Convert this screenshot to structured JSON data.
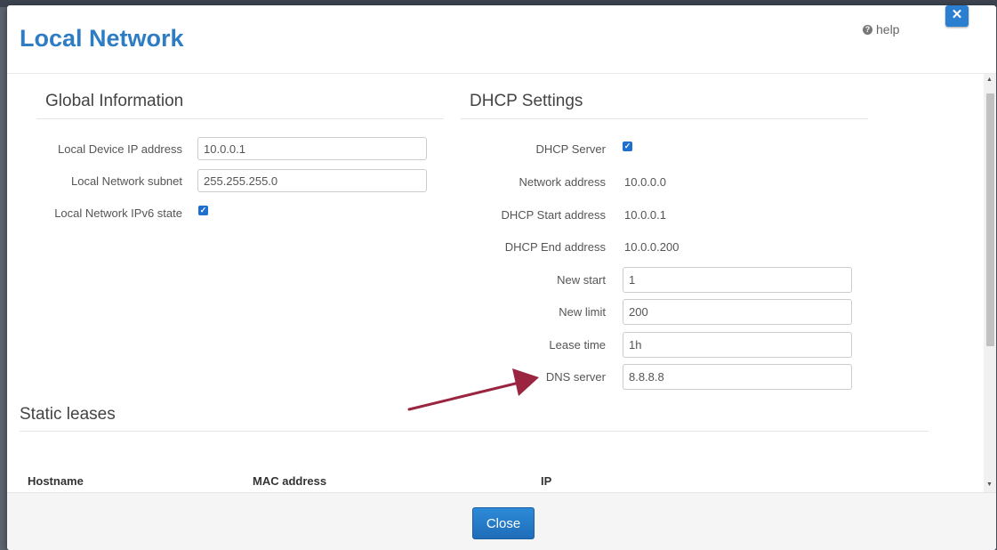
{
  "modal": {
    "title": "Local Network",
    "help_label": "help",
    "close_label": "Close"
  },
  "global_info": {
    "title": "Global Information",
    "device_ip": {
      "label": "Local Device IP address",
      "value": "10.0.0.1"
    },
    "subnet": {
      "label": "Local Network subnet",
      "value": "255.255.255.0"
    },
    "ipv6": {
      "label": "Local Network IPv6 state",
      "checked": true
    }
  },
  "dhcp": {
    "title": "DHCP Settings",
    "server": {
      "label": "DHCP Server",
      "checked": true
    },
    "network_address": {
      "label": "Network address",
      "value": "10.0.0.0"
    },
    "start_address": {
      "label": "DHCP Start address",
      "value": "10.0.0.1"
    },
    "end_address": {
      "label": "DHCP End address",
      "value": "10.0.0.200"
    },
    "new_start": {
      "label": "New start",
      "value": "1"
    },
    "new_limit": {
      "label": "New limit",
      "value": "200"
    },
    "lease_time": {
      "label": "Lease time",
      "value": "1h"
    },
    "dns_server": {
      "label": "DNS server",
      "value": "8.8.8.8"
    }
  },
  "static_leases": {
    "title": "Static leases",
    "columns": [
      "Hostname",
      "MAC address",
      "IP"
    ]
  },
  "colors": {
    "title": "#2d7cc4",
    "accent": "#1f6fd0",
    "annotation_arrow": "#9b2440"
  },
  "icons": {
    "help": "question-circle-icon",
    "close": "close-x-icon",
    "check": "checkmark-icon"
  }
}
